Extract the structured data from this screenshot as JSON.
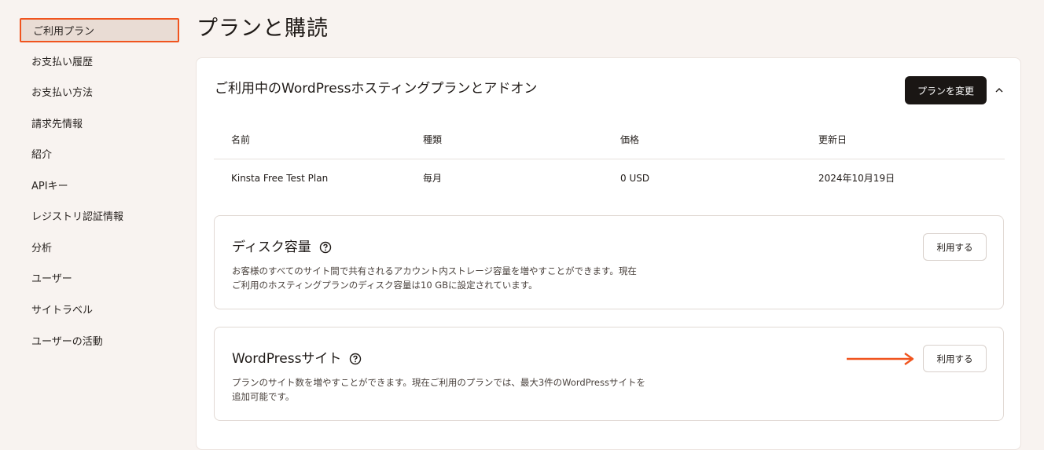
{
  "sidebar": {
    "items": [
      {
        "label": "ご利用プラン",
        "active": true
      },
      {
        "label": "お支払い履歴"
      },
      {
        "label": "お支払い方法"
      },
      {
        "label": "請求先情報"
      },
      {
        "label": "紹介"
      },
      {
        "label": "APIキー"
      },
      {
        "label": "レジストリ認証情報"
      },
      {
        "label": "分析"
      },
      {
        "label": "ユーザー"
      },
      {
        "label": "サイトラベル"
      },
      {
        "label": "ユーザーの活動"
      }
    ]
  },
  "page": {
    "title": "プランと購読"
  },
  "plan_card": {
    "title": "ご利用中のWordPressホスティングプランとアドオン",
    "change_button": "プランを変更",
    "columns": [
      "名前",
      "種類",
      "価格",
      "更新日"
    ],
    "rows": [
      [
        "Kinsta Free Test Plan",
        "毎月",
        "0 USD",
        "2024年10月19日"
      ]
    ]
  },
  "addons": [
    {
      "title": "ディスク容量",
      "description_line1": "お客様のすべてのサイト間で共有されるアカウント内ストレージ容量を増やすことができます。現在",
      "description_line2": "ご利用のホスティングプランのディスク容量は10 GBに設定されています。",
      "button": "利用する"
    },
    {
      "title": "WordPressサイト",
      "description_line1": "プランのサイト数を増やすことができます。現在ご利用のプランでは、最大3件のWordPressサイトを",
      "description_line2": "追加可能です。",
      "button": "利用する"
    }
  ],
  "colors": {
    "accent": "#f0541e",
    "dark_button": "#1a1614",
    "background": "#f8f3f0"
  }
}
